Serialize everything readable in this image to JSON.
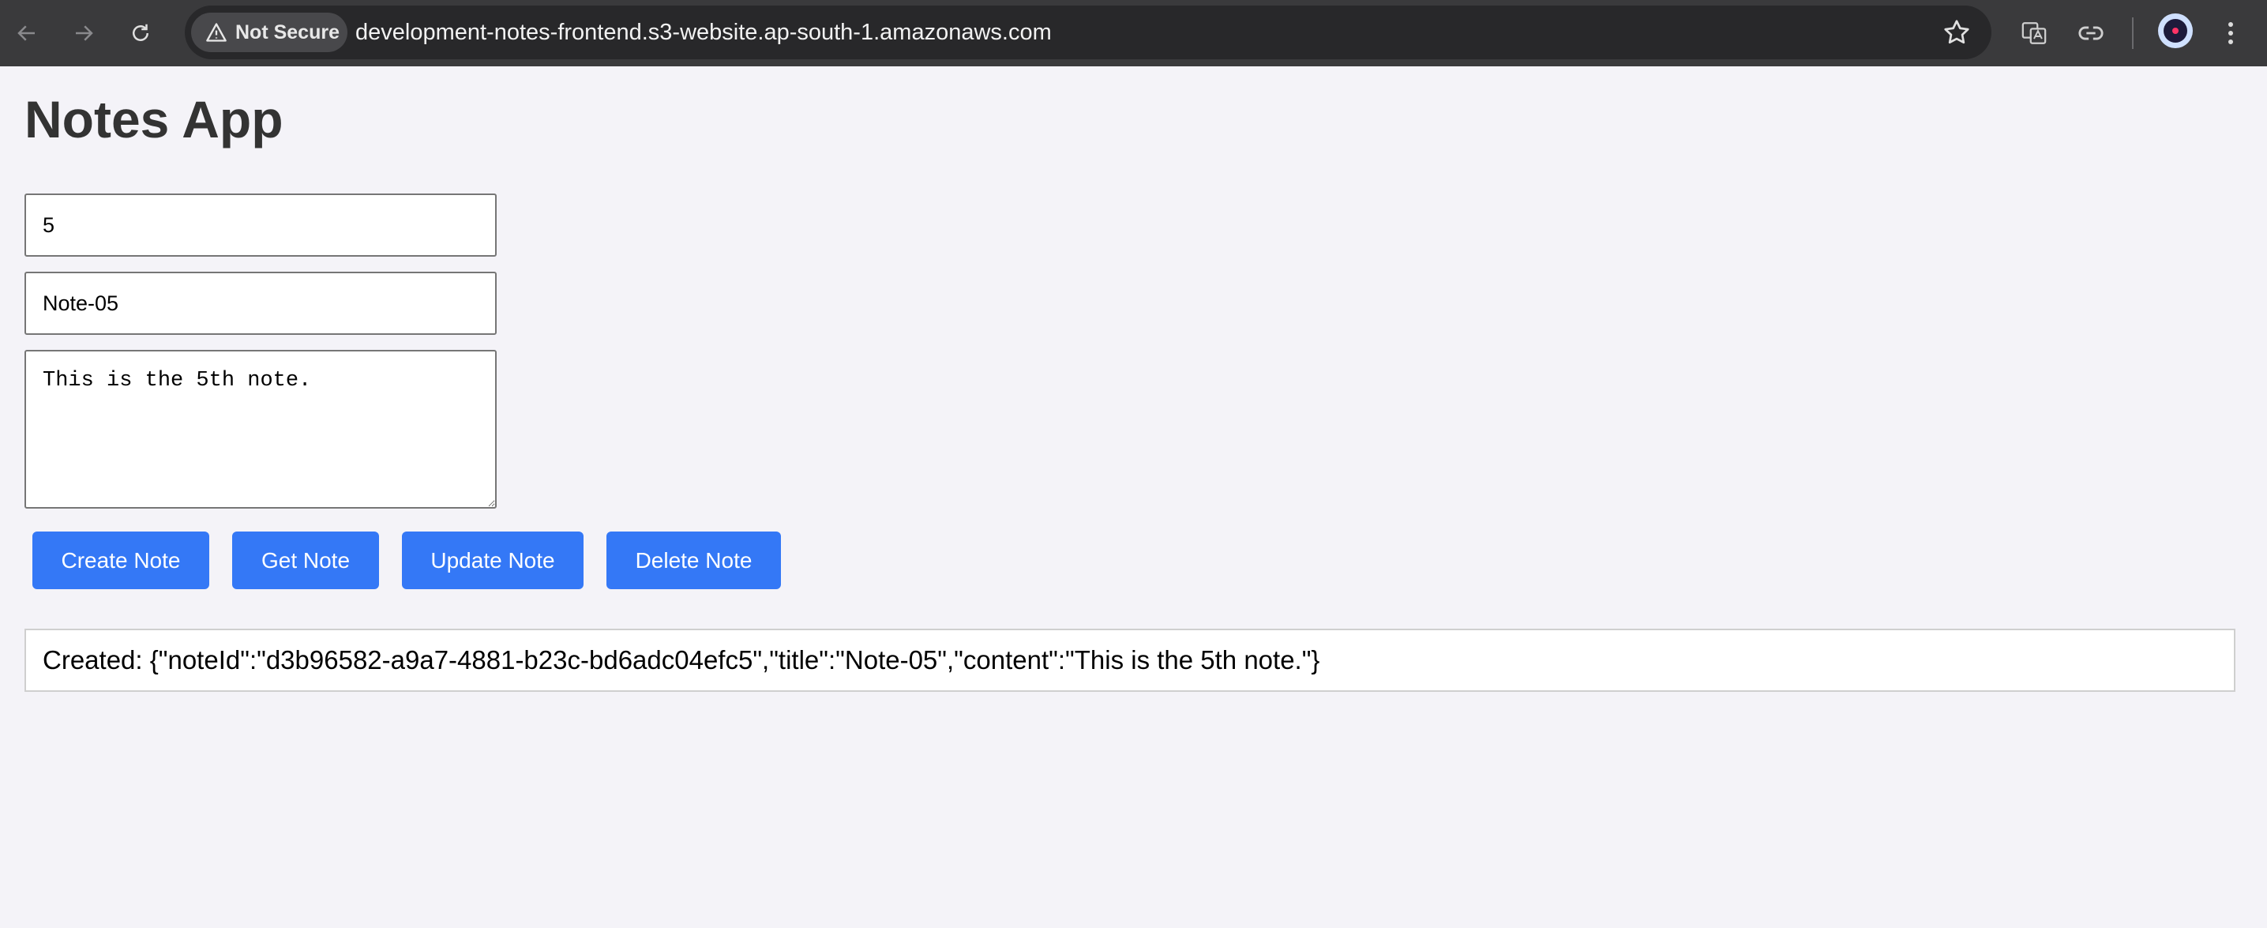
{
  "browser": {
    "security_label": "Not Secure",
    "url": "development-notes-frontend.s3-website.ap-south-1.amazonaws.com",
    "icons": [
      "back-icon",
      "forward-icon",
      "reload-icon",
      "warning-icon",
      "bookmark-star-icon",
      "translate-icon",
      "link-icon",
      "profile-avatar",
      "more-menu-icon"
    ],
    "colors": {
      "toolbar": "#3a3a3c",
      "omnibox": "#28282a"
    }
  },
  "app": {
    "title": "Notes App",
    "note_id_value": "5",
    "note_title_value": "Note-05",
    "note_content_value": "This is the 5th note.",
    "buttons": {
      "create": "Create Note",
      "get": "Get Note",
      "update": "Update Note",
      "delete": "Delete Note"
    },
    "result_text": "Created: {\"noteId\":\"d3b96582-a9a7-4881-b23c-bd6adc04efc5\",\"title\":\"Note-05\",\"content\":\"This is the 5th note.\"}",
    "colors": {
      "button": "#3478f6",
      "page_background": "#f4f3f8",
      "title": "#333333"
    }
  }
}
